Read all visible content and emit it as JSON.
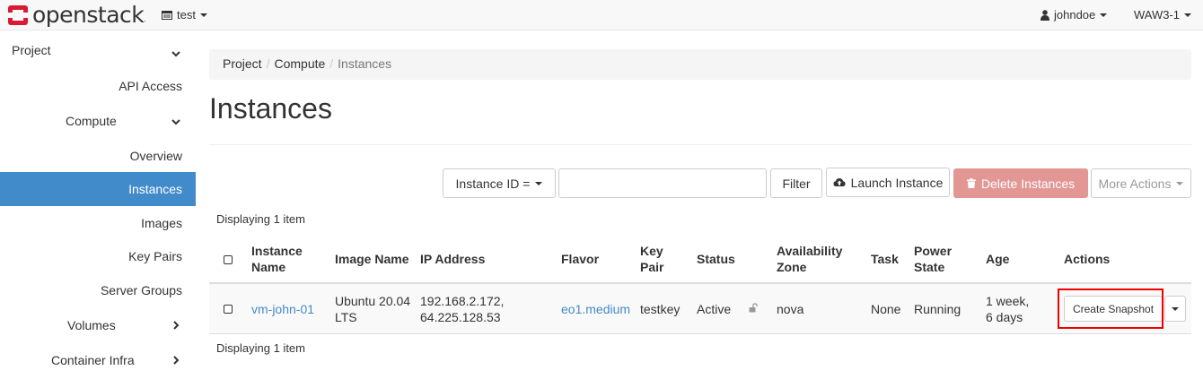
{
  "header": {
    "logo_text": "openstack",
    "logo_mark": ".",
    "project": "test",
    "user": "johndoe",
    "region": "WAW3-1"
  },
  "sidebar": {
    "items": [
      {
        "label": "Project",
        "expanded": true
      },
      {
        "label": "API Access"
      },
      {
        "label": "Compute",
        "expanded": true
      },
      {
        "label": "Overview"
      },
      {
        "label": "Instances",
        "active": true
      },
      {
        "label": "Images"
      },
      {
        "label": "Key Pairs"
      },
      {
        "label": "Server Groups"
      },
      {
        "label": "Volumes",
        "expanded": false
      },
      {
        "label": "Container Infra",
        "expanded": false
      }
    ]
  },
  "breadcrumb": [
    "Project",
    "Compute",
    "Instances"
  ],
  "page_title": "Instances",
  "toolbar": {
    "filter_field": "Instance ID =",
    "filter_value": "",
    "filter_label": "Filter",
    "launch_label": "Launch Instance",
    "delete_label": "Delete Instances",
    "more_label": "More Actions"
  },
  "display_count_top": "Displaying 1 item",
  "display_count_bottom": "Displaying 1 item",
  "table": {
    "headers": {
      "instance_name": [
        "Instance",
        "Name"
      ],
      "image_name": "Image Name",
      "ip_address": "IP Address",
      "flavor": "Flavor",
      "key_pair": [
        "Key",
        "Pair"
      ],
      "status": "Status",
      "availability_zone": [
        "Availability",
        "Zone"
      ],
      "task": "Task",
      "power_state": [
        "Power",
        "State"
      ],
      "age": "Age",
      "actions": "Actions"
    },
    "rows": [
      {
        "instance_name": "vm-john-01",
        "image_name": [
          "Ubuntu 20.04",
          "LTS"
        ],
        "ip_address": [
          "192.168.2.172,",
          "64.225.128.53"
        ],
        "flavor": "eo1.medium",
        "key_pair": "testkey",
        "status": "Active",
        "locked": false,
        "availability_zone": "nova",
        "task": "None",
        "power_state": "Running",
        "age": [
          "1 week,",
          "6 days"
        ],
        "action_label": "Create Snapshot"
      }
    ]
  },
  "colors": {
    "active_nav": "#428bca",
    "link": "#428bca",
    "danger_disabled": "#e39795",
    "highlight": "#ee0000"
  },
  "icons": [
    "openstack-logo-icon",
    "project-icon",
    "user-icon",
    "chevron-down-icon",
    "chevron-right-icon",
    "cloud-upload-icon",
    "trash-icon",
    "unlock-icon",
    "caret-down-icon"
  ]
}
